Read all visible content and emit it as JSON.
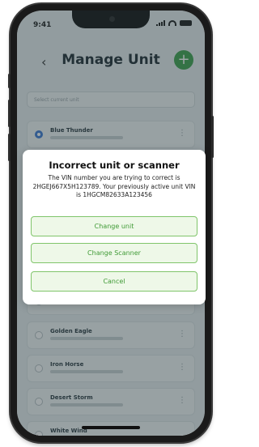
{
  "status": {
    "time": "9:41"
  },
  "header": {
    "back_icon": "‹",
    "title": "Manage Unit",
    "add_icon": "+"
  },
  "select": {
    "placeholder": "Select current unit"
  },
  "units": [
    {
      "name": "Blue Thunder",
      "selected": true
    },
    {
      "name": "Golden Eagle",
      "selected": false
    },
    {
      "name": "Iron Horse",
      "selected": false
    },
    {
      "name": "Desert Storm",
      "selected": false
    },
    {
      "name": "White Wind",
      "selected": false
    }
  ],
  "dialog": {
    "title": "Incorrect unit or scanner",
    "message": "The VIN number you are trying to correct is 2HGEJ667X5H123789. Your previously active unit VIN is 1HGCM82633A123456",
    "buttons": {
      "change_unit": "Change unit",
      "change_scanner": "Change Scanner",
      "cancel": "Cancel"
    }
  },
  "colors": {
    "accent_green": "#3fa34d",
    "button_border": "#80c56b",
    "button_text": "#3f9a35",
    "radio_selected": "#3d7bd6"
  }
}
